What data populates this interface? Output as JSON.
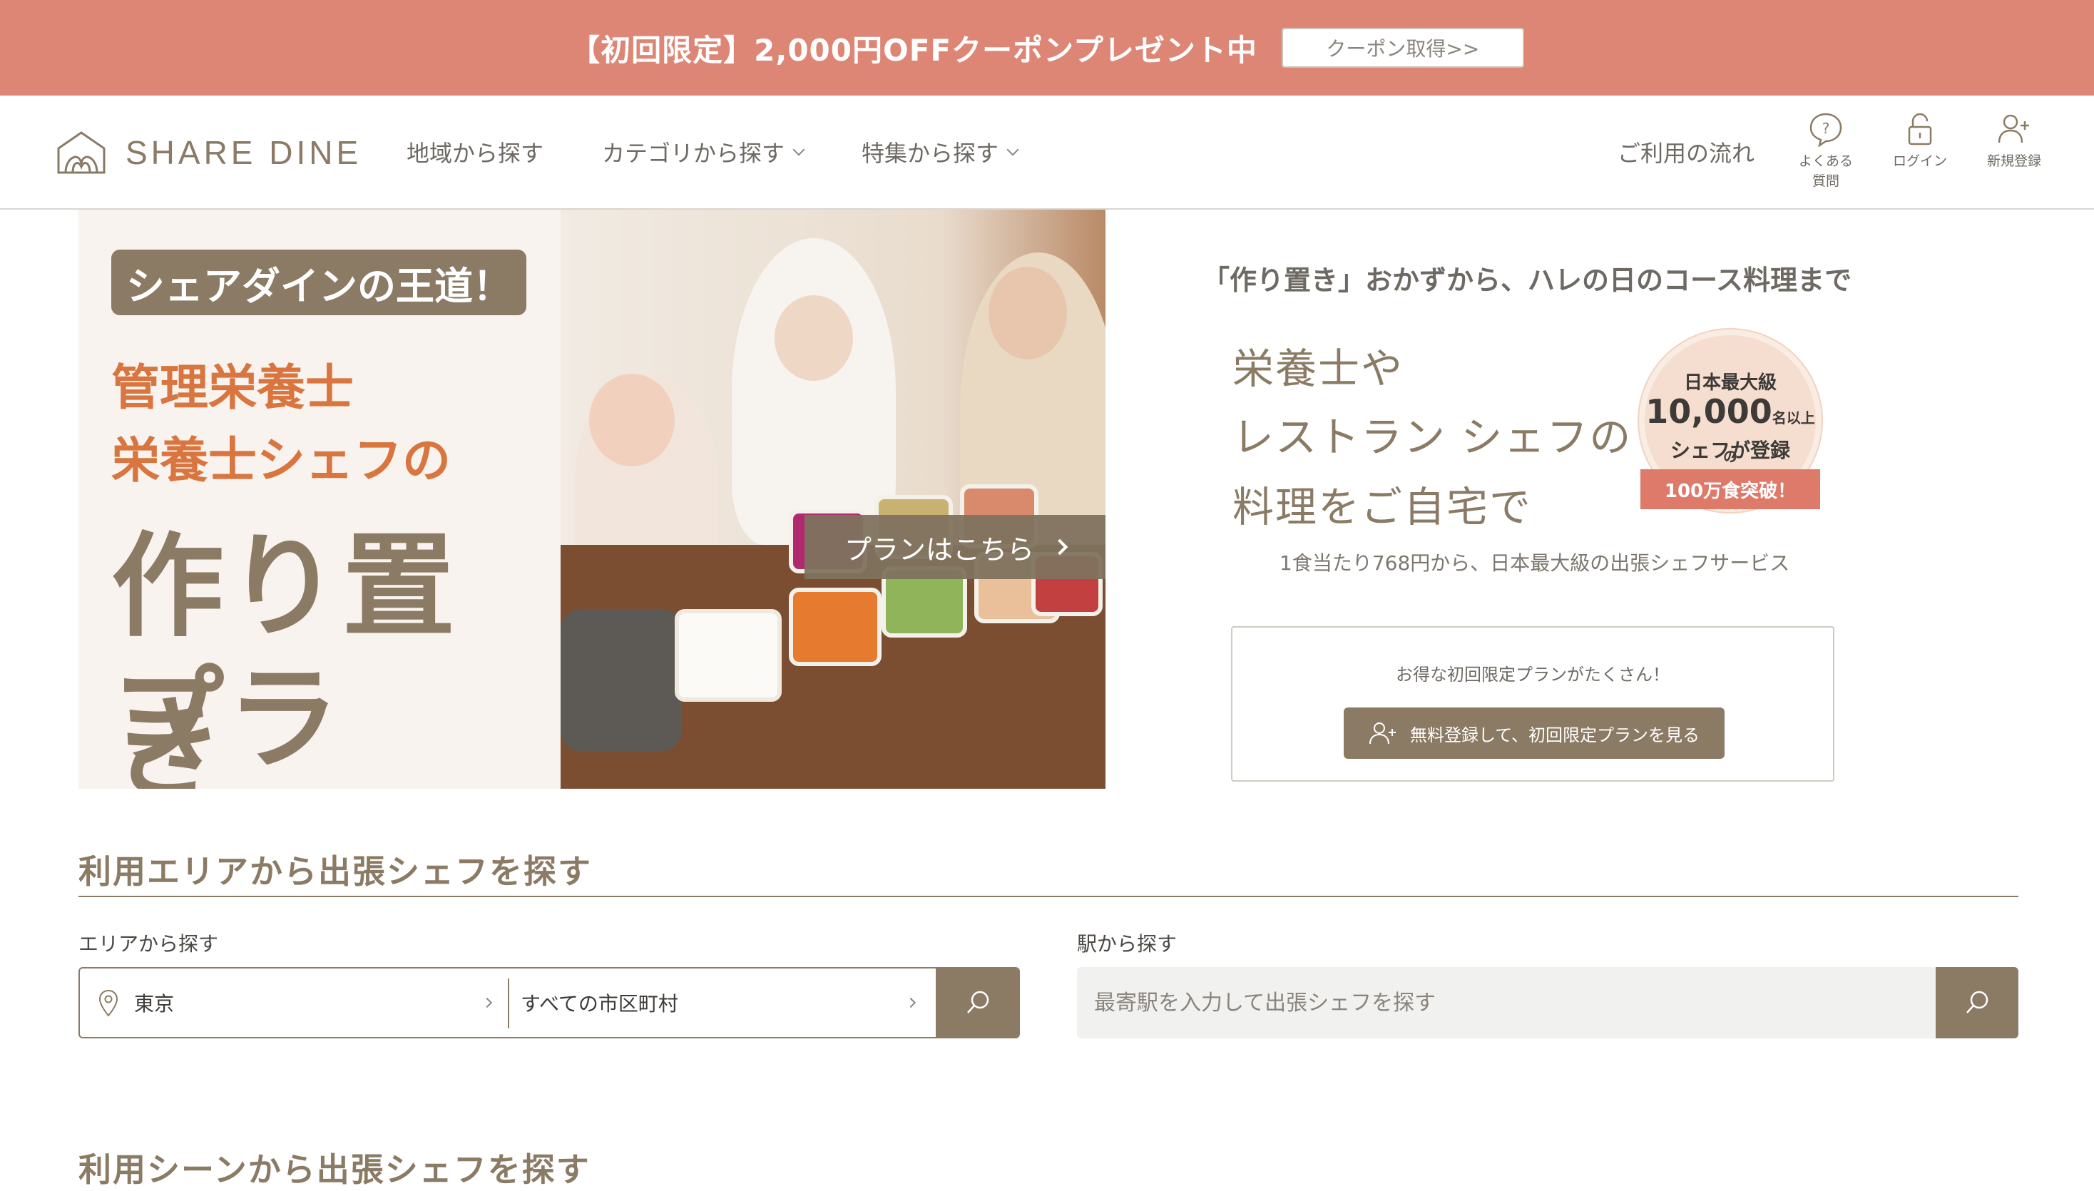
{
  "promo": {
    "text": "【初回限定】2,000円OFFクーポンプレゼント中",
    "button": "クーポン取得>>"
  },
  "header": {
    "logo_text": "SHARE DINE",
    "nav": [
      {
        "label": "地域から探す",
        "dropdown": false
      },
      {
        "label": "カテゴリから探す",
        "dropdown": true
      },
      {
        "label": "特集から探す",
        "dropdown": true
      }
    ],
    "flow": "ご利用の流れ",
    "icons": [
      {
        "name": "question-icon",
        "label_line1": "よくある",
        "label_line2": "質問"
      },
      {
        "name": "lock-icon",
        "label_line1": "ログイン",
        "label_line2": ""
      },
      {
        "name": "user-plus-icon",
        "label_line1": "新規登録",
        "label_line2": ""
      }
    ]
  },
  "banner": {
    "pill": "シェアダインの王道！",
    "line1": "管理栄養士",
    "line2": "栄養士シェフの",
    "line3": "作り置き",
    "line4": "プラン!!",
    "button": "プランはこちら"
  },
  "hero": {
    "tagline": "「作り置き」おかずから、ハレの日のコース料理まで",
    "headline": [
      "栄養士や",
      "レストラン シェフの",
      "料理をご自宅で"
    ],
    "medal": {
      "line1": "日本最大級",
      "number": "10,000",
      "suffix": "名以上の",
      "line3": "シェフが登録",
      "ribbon": "100万食突破！"
    },
    "subline": "1食当たり768円から、日本最大級の出張シェフサービス",
    "box_text": "お得な初回限定プランがたくさん！",
    "cta": "無料登録して、初回限定プランを見る"
  },
  "area_search": {
    "title": "利用エリアから出張シェフを探す",
    "area_label": "エリアから探す",
    "prefecture": "東京",
    "city": "すべての市区町村",
    "station_label": "駅から探す",
    "station_placeholder": "最寄駅を入力して出張シェフを探す"
  },
  "scene_search": {
    "title": "利用シーンから出張シェフを探す"
  },
  "colors": {
    "promo_bg": "#dd8676",
    "brand_brown": "#8b7b65",
    "accent_orange": "#d9753f",
    "ribbon_red": "#dd7a6a"
  }
}
